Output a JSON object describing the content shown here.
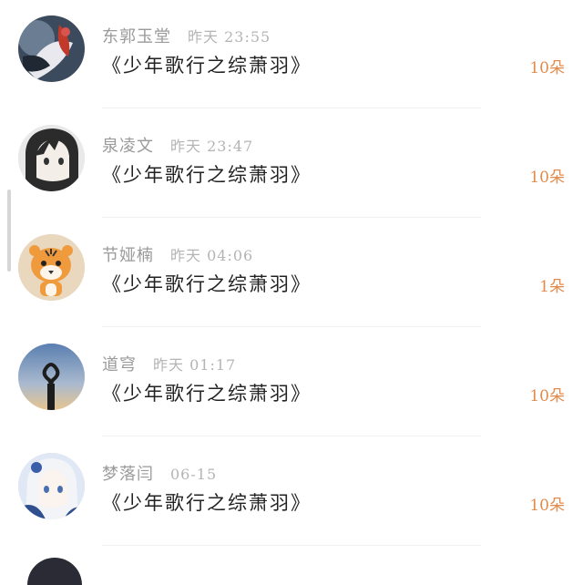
{
  "comments": [
    {
      "name": "东郭玉堂",
      "time": "昨天 23:55",
      "title": "《少年歌行之综萧羽》",
      "count": "10朵",
      "avatar_icon": "ink-art-avatar"
    },
    {
      "name": "泉凌文",
      "time": "昨天 23:47",
      "title": "《少年歌行之综萧羽》",
      "count": "10朵",
      "avatar_icon": "anime-girl-avatar"
    },
    {
      "name": "节娅楠",
      "time": "昨天 04:06",
      "title": "《少年歌行之综萧羽》",
      "count": "1朵",
      "avatar_icon": "tiger-avatar"
    },
    {
      "name": "道穹",
      "time": "昨天 01:17",
      "title": "《少年歌行之综萧羽》",
      "count": "10朵",
      "avatar_icon": "heart-sky-avatar"
    },
    {
      "name": "梦落闫",
      "time": "06-15",
      "title": "《少年歌行之综萧羽》",
      "count": "10朵",
      "avatar_icon": "anime-white-hair-avatar"
    }
  ],
  "colors": {
    "count": "#e38a4a",
    "name": "#9a9a9a",
    "title": "#222222"
  }
}
